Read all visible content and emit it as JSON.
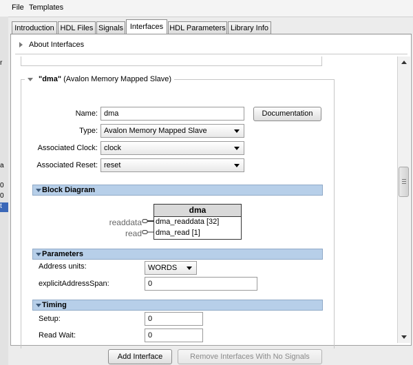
{
  "menubar": {
    "items": [
      "File",
      "Templates"
    ]
  },
  "tabs": [
    {
      "label": "Introduction"
    },
    {
      "label": "HDL Files"
    },
    {
      "label": "Signals"
    },
    {
      "label": "Interfaces",
      "active": true
    },
    {
      "label": "HDL Parameters"
    },
    {
      "label": "Library Info"
    }
  ],
  "about": {
    "label": "About Interfaces"
  },
  "interface": {
    "name_title": "\"dma\"",
    "type_title": "(Avalon Memory Mapped Slave)",
    "name_label": "Name:",
    "name_value": "dma",
    "documentation_button": "Documentation",
    "type_label": "Type:",
    "type_value": "Avalon Memory Mapped Slave",
    "clock_label": "Associated Clock:",
    "clock_value": "clock",
    "reset_label": "Associated Reset:",
    "reset_value": "reset"
  },
  "block_diagram": {
    "title": "Block Diagram",
    "block_name": "dma",
    "ports": [
      {
        "outer": "readdata",
        "inner": "dma_readdata [32]"
      },
      {
        "outer": "read",
        "inner": "dma_read [1]"
      }
    ]
  },
  "parameters": {
    "title": "Parameters",
    "address_units_label": "Address units:",
    "address_units_value": "WORDS",
    "span_label": "explicitAddressSpan:",
    "span_value": "0"
  },
  "timing": {
    "title": "Timing",
    "setup_label": "Setup:",
    "setup_value": "0",
    "read_wait_label": "Read Wait:",
    "read_wait_value": "0"
  },
  "footer": {
    "add_button": "Add Interface",
    "remove_button": "Remove Interfaces With No Signals"
  },
  "left_edge": [
    "r",
    "a",
    "0",
    "0",
    "t"
  ]
}
